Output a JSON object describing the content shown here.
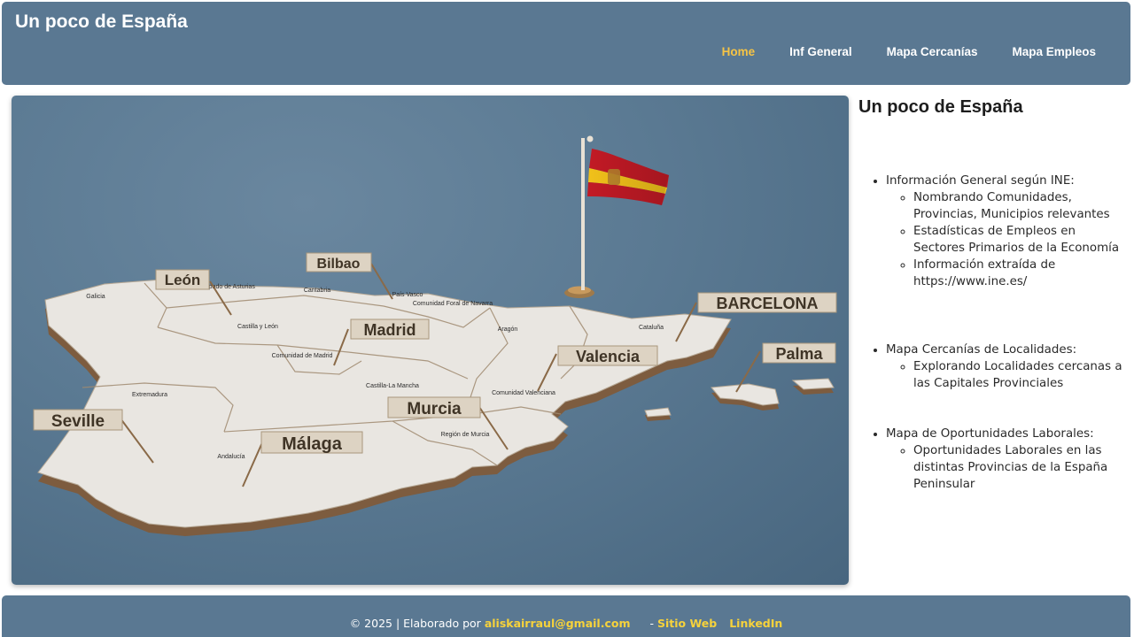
{
  "header": {
    "brand": "Un poco de España",
    "nav": [
      {
        "label": "Home",
        "active": true
      },
      {
        "label": "Inf General",
        "active": false
      },
      {
        "label": "Mapa Cercanías",
        "active": false
      },
      {
        "label": "Mapa Empleos",
        "active": false
      }
    ]
  },
  "hero": {
    "signs": [
      "León",
      "Bilbao",
      "BARCELONA",
      "Madrid",
      "Valencia",
      "Palma",
      "Seville",
      "Murcia",
      "Málaga"
    ],
    "regions": [
      "Galicia",
      "Principado de Asturias",
      "Cantabria",
      "País Vasco",
      "Comunidad Foral de Navarra",
      "Aragón",
      "Cataluña",
      "Castilla y León",
      "Comunidad de Madrid",
      "Castilla-La Mancha",
      "Extremadura",
      "Comunidad Valenciana",
      "Región de Murcia",
      "Andalucía"
    ]
  },
  "aside": {
    "title": "Un poco de España",
    "items": [
      {
        "label": "Información General según INE:",
        "subitems": [
          "Nombrando Comunidades, Provincias, Municipios relevantes",
          "Estadísticas de Empleos en Sectores Primarios de la Economía",
          "Información extraída de https://www.ine.es/"
        ]
      },
      {
        "label": "Mapa Cercanías de Localidades:",
        "subitems": [
          "Explorando Localidades cercanas a las Capitales Provinciales"
        ]
      },
      {
        "label": "Mapa de Oportunidades Laborales:",
        "subitems": [
          "Oportunidades Laborales en las distintas Provincias de la España Peninsular"
        ]
      }
    ]
  },
  "footer": {
    "copyright": "© 2025 | Elaborado por",
    "email": "aliskairraul@gmail.com",
    "separator": "-",
    "website": "Sitio Web",
    "linkedin": "LinkedIn"
  },
  "colors": {
    "bar": "#5a7892",
    "active_nav": "#f6c445",
    "footer_link": "#f6d23b",
    "map_surface": "#e9e6e1",
    "sign_face": "#ddd3c3"
  }
}
